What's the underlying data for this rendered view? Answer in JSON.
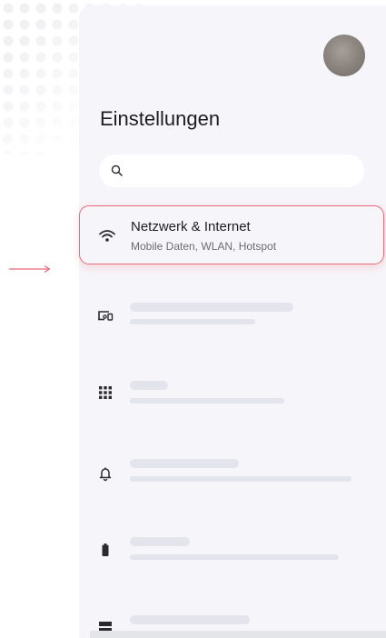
{
  "settings": {
    "title": "Einstellungen",
    "search": {
      "value": "",
      "placeholder": ""
    },
    "highlighted_item": {
      "title": "Netzwerk & Internet",
      "subtitle": "Mobile Daten, WLAN, Hotspot",
      "icon": "wifi-icon"
    },
    "placeholder_rows": [
      {
        "icon": "connected-devices-icon"
      },
      {
        "icon": "apps-grid-icon"
      },
      {
        "icon": "notifications-bell-icon"
      },
      {
        "icon": "battery-icon"
      },
      {
        "icon": "storage-icon"
      }
    ]
  },
  "colors": {
    "highlight_border": "#e86b7a",
    "panel_background": "#f6f6fa",
    "skeleton_bar": "#e3e4ec"
  }
}
